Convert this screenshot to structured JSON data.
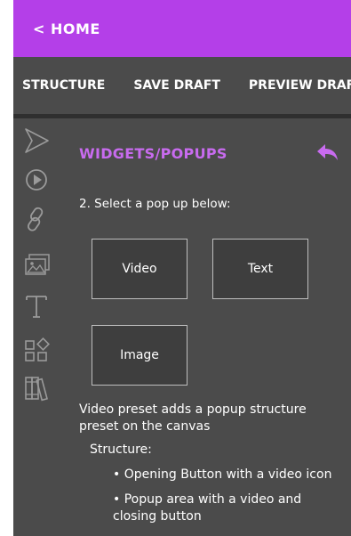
{
  "header": {
    "home_label": "< HOME"
  },
  "tabs": [
    {
      "label": "STRUCTURE"
    },
    {
      "label": "SAVE DRAFT"
    },
    {
      "label": "PREVIEW DRAFT"
    }
  ],
  "rail_icons": [
    "cursor-arrow-icon",
    "play-circle-icon",
    "link-icon",
    "image-gallery-icon",
    "text-icon",
    "widgets-icon",
    "library-icon"
  ],
  "panel": {
    "title": "WIDGETS/POPUPS",
    "instruction": "2. Select a pop up below:",
    "options": [
      {
        "label": "Video"
      },
      {
        "label": "Text"
      },
      {
        "label": "Image"
      }
    ],
    "description": "Video preset adds a popup structure preset on the canvas",
    "structure_label": "Structure:",
    "bullets": [
      "• Opening Button with a video icon",
      "• Popup area with a video and closing button"
    ]
  },
  "colors": {
    "accent": "#b43fe8",
    "accent_text": "#c86bef",
    "panel_bg": "#4b4b4b",
    "icon": "#9a9a9a"
  }
}
